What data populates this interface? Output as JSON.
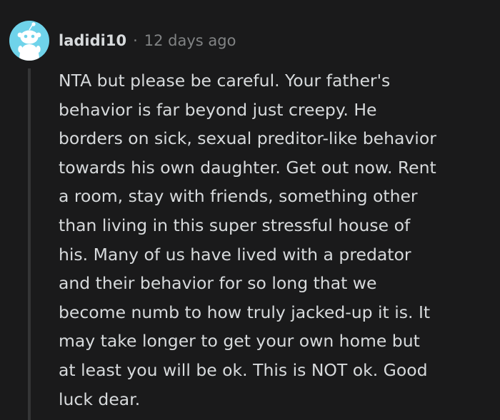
{
  "comment": {
    "username": "ladidi10",
    "separator": "·",
    "timestamp": "12 days ago",
    "avatar_icon": "reddit-snoo-avatar-icon",
    "avatar_color": "#6fd3ea",
    "body_lines": [
      "NTA but please be careful. Your father's",
      "behavior is far beyond just creepy. He",
      "borders on sick, sexual preditor-like behavior",
      "towards his own daughter. Get out now. Rent",
      "a room, stay with friends, something other",
      "than living in this super stressful house of",
      "his. Many of us have lived with a predator",
      "and their behavior for so long that we",
      "become numb to how truly jacked-up it is. It",
      "may take longer to get your own home but",
      "at least you will be ok. This is NOT ok. Good",
      "luck dear."
    ]
  }
}
